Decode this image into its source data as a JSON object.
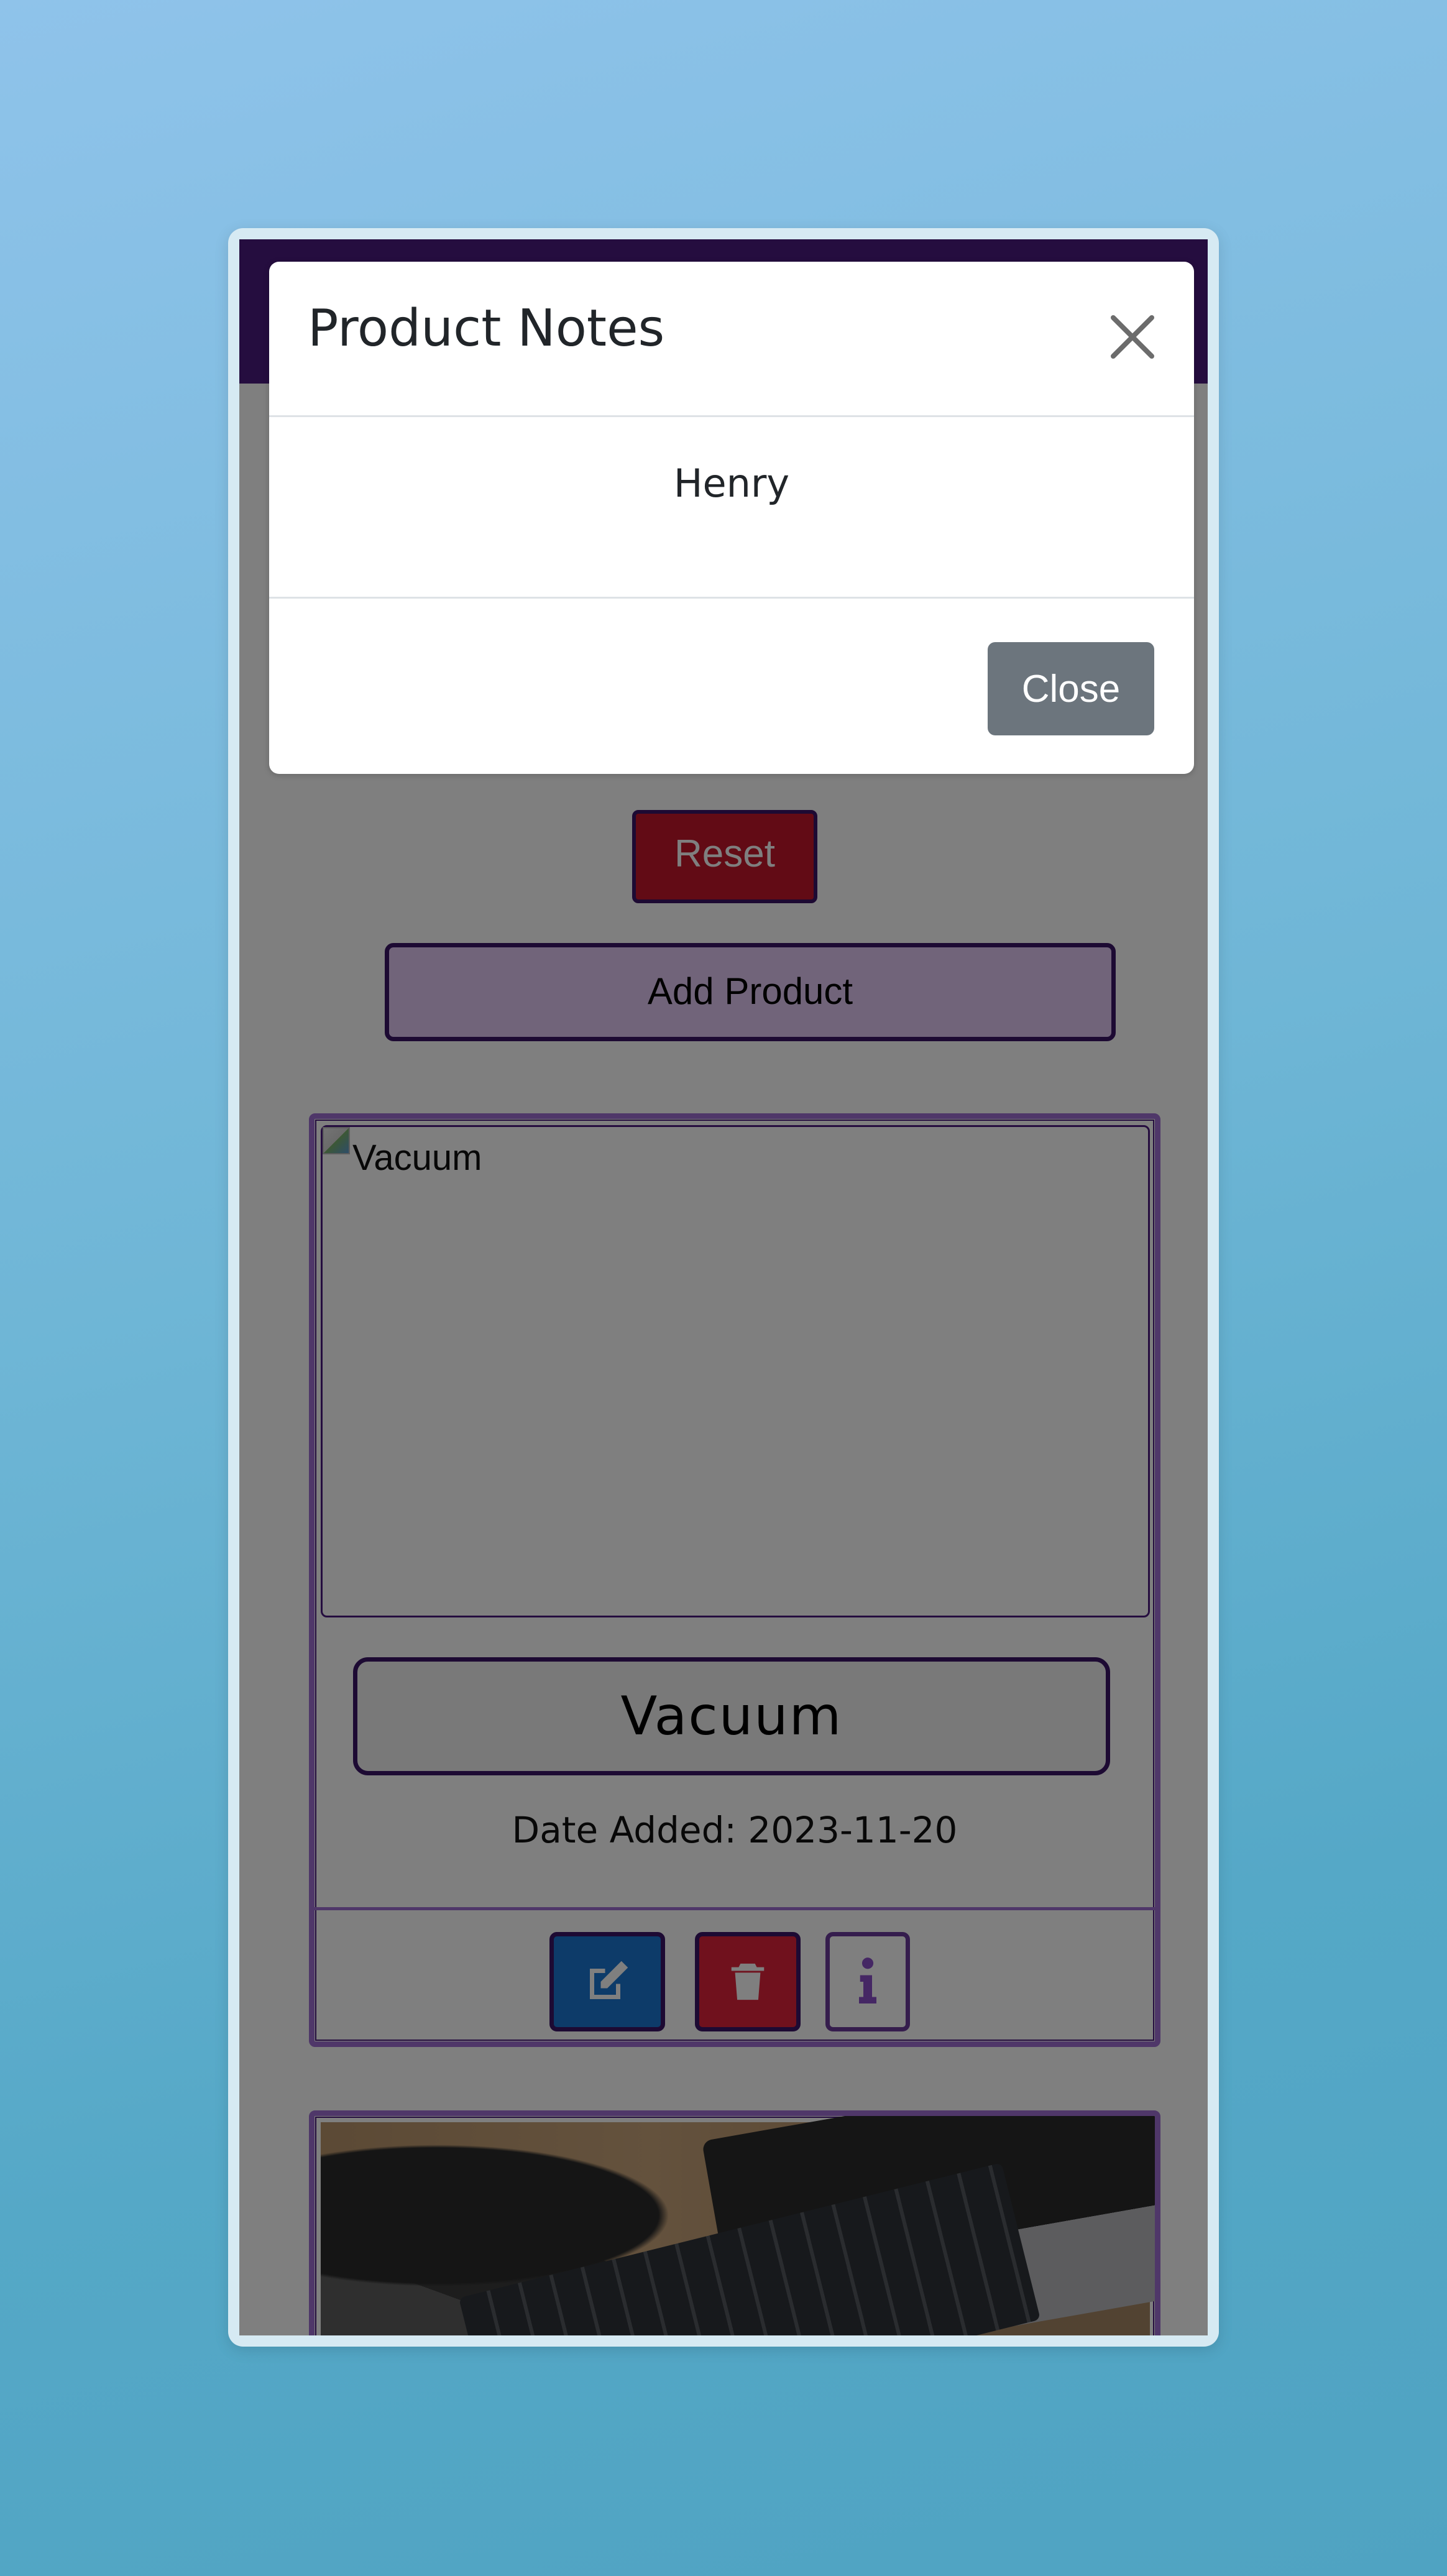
{
  "modal": {
    "title": "Product Notes",
    "body_text": "Henry",
    "close_button_label": "Close",
    "close_icon": "close-icon"
  },
  "page": {
    "reset_label": "Reset",
    "add_product_label": "Add Product"
  },
  "products": [
    {
      "name": "Vacuum",
      "image_alt": "Vacuum",
      "date_added": "Date Added: 2023-11-20",
      "actions": [
        "edit-icon",
        "trash-icon",
        "info-icon"
      ]
    },
    {
      "image_subject": "keyboard and laptop photo"
    }
  ],
  "colors": {
    "header": "#4b1a7e",
    "reset": "#c4172a",
    "add_product": "#e2c9f5",
    "card_border": "#9e6ed3",
    "edit": "#1a76d2",
    "delete": "#e0223a",
    "modal_button": "#6c757d"
  }
}
